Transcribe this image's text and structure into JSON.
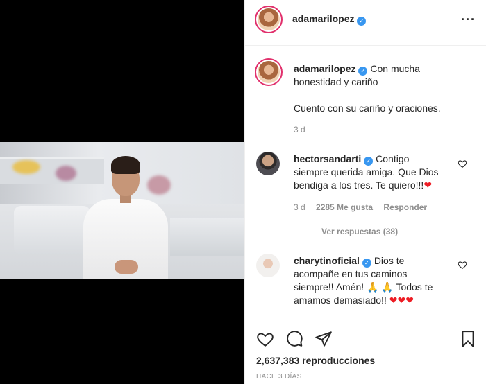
{
  "post": {
    "username": "adamarilopez",
    "more_icon": "more-icon"
  },
  "caption": {
    "username": "adamarilopez",
    "line1": "Con mucha",
    "line2": "honestidad y cariño",
    "line3": "Cuento con su cariño y oraciones.",
    "time": "3 d"
  },
  "comments": [
    {
      "username": "hectorsandarti",
      "text_lines": [
        "Contigo",
        "siempre querida amiga. Que Dios",
        "bendiga a los tres. Te quiero!!!"
      ],
      "emoji": "❤",
      "time": "3 d",
      "likes": "2285 Me gusta",
      "reply": "Responder",
      "view_replies": "Ver respuestas (38)"
    },
    {
      "username": "charytinoficial",
      "text_lines": [
        "Dios te",
        "acompañe en tus caminos",
        "siempre!! Amén!",
        "Todos te",
        "amamos demasiado!!"
      ],
      "pray_emoji": "🙏",
      "heart_emoji": "❤"
    }
  ],
  "footer": {
    "views": "2,637,383 reproducciones",
    "timestamp": "HACE 3 DÍAS"
  },
  "colors": {
    "verified": "#3897f0",
    "heart": "#ed1c24",
    "text_secondary": "#8e8e8e"
  }
}
